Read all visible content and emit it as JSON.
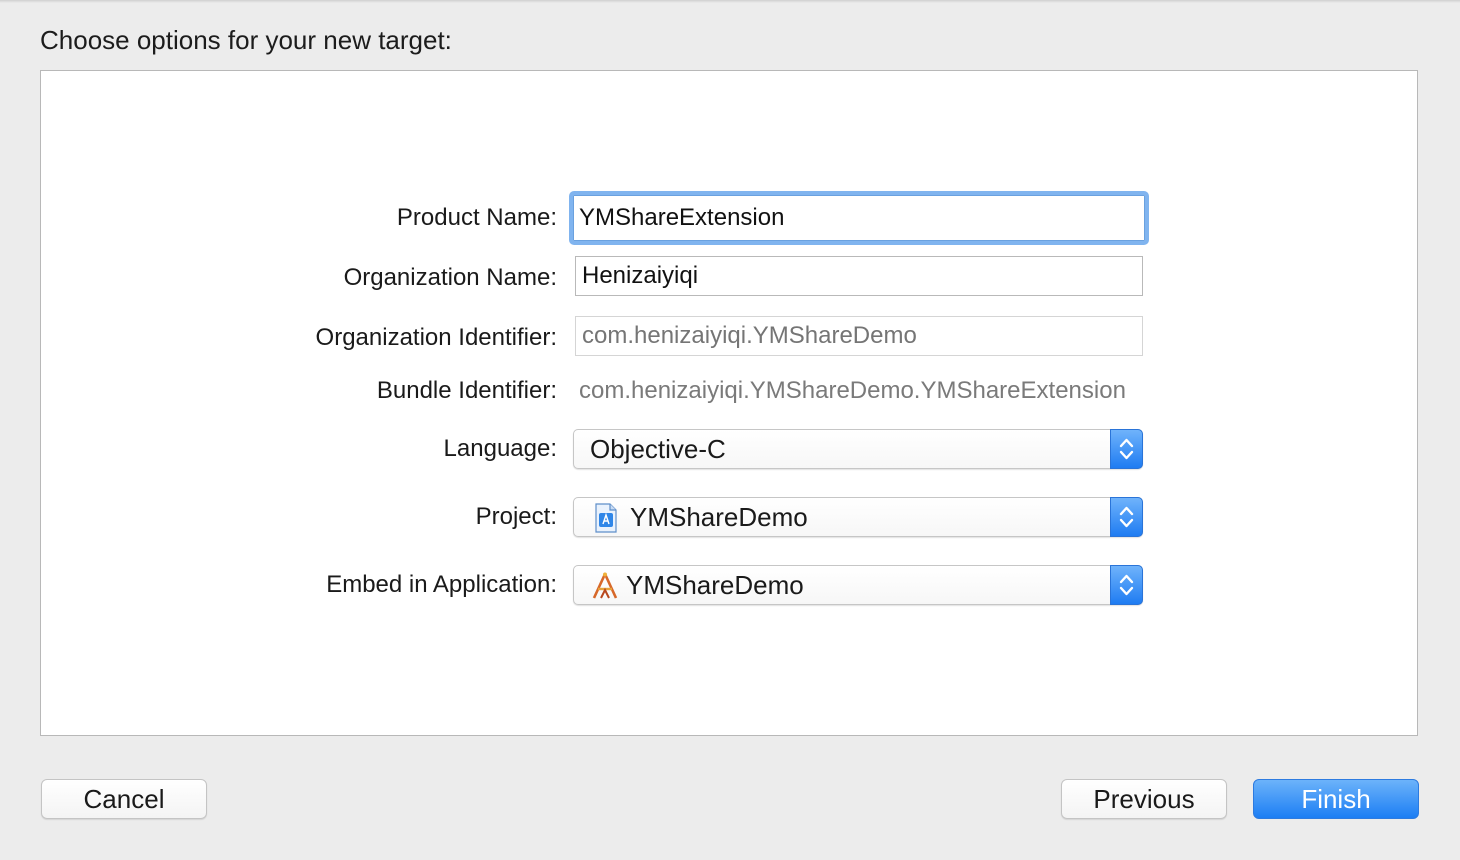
{
  "dialog": {
    "heading": "Choose options for your new target:"
  },
  "form": {
    "product_name": {
      "label": "Product Name:",
      "value": "YMShareExtension"
    },
    "organization_name": {
      "label": "Organization Name:",
      "value": "Henizaiyiqi"
    },
    "organization_identifier": {
      "label": "Organization Identifier:",
      "placeholder": "com.henizaiyiqi.YMShareDemo"
    },
    "bundle_identifier": {
      "label": "Bundle Identifier:",
      "value": "com.henizaiyiqi.YMShareDemo.YMShareExtension"
    },
    "language": {
      "label": "Language:",
      "selected": "Objective-C"
    },
    "project": {
      "label": "Project:",
      "selected": "YMShareDemo",
      "icon": "xcode-project-icon"
    },
    "embed_in_application": {
      "label": "Embed in Application:",
      "selected": "YMShareDemo",
      "icon": "app-icon"
    }
  },
  "buttons": {
    "cancel": "Cancel",
    "previous": "Previous",
    "finish": "Finish"
  },
  "colors": {
    "accent": "#1c7ef4",
    "focus_ring": "#80b4ef"
  }
}
